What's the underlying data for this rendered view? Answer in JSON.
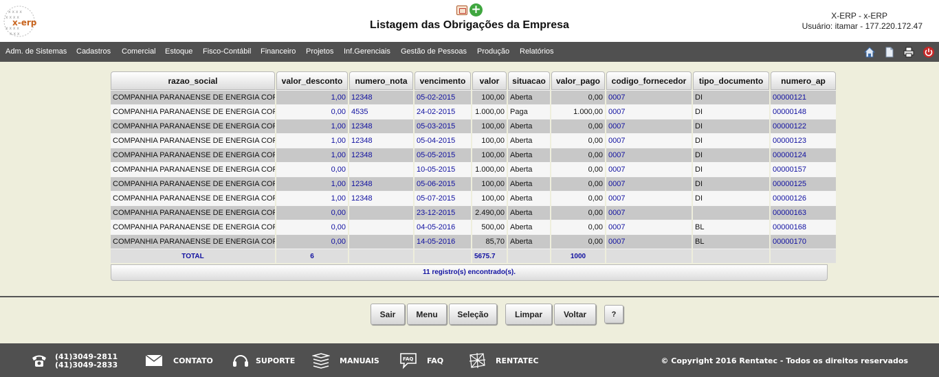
{
  "header": {
    "logo_text": "x-erp",
    "title": "Listagem das Obrigações da Empresa",
    "system_name": "X-ERP - x-ERP",
    "user_info": "Usuário: itamar - 177.220.172.47"
  },
  "menu": {
    "items": [
      "Adm. de Sistemas",
      "Cadastros",
      "Comercial",
      "Estoque",
      "Fisco-Contábil",
      "Financeiro",
      "Projetos",
      "Inf.Gerenciais",
      "Gestão de Pessoas",
      "Produção",
      "Relatórios"
    ]
  },
  "table": {
    "columns": [
      "razao_social",
      "valor_desconto",
      "numero_nota",
      "vencimento",
      "valor",
      "situacao",
      "valor_pago",
      "codigo_fornecedor",
      "tipo_documento",
      "numero_ap"
    ],
    "rows": [
      [
        "COMPANHIA PARANAENSE DE ENERGIA COPEL",
        "1,00",
        "12348",
        "05-02-2015",
        "100,00",
        "Aberta",
        "0,00",
        "0007",
        "DI",
        "00000121"
      ],
      [
        "COMPANHIA PARANAENSE DE ENERGIA COPEL",
        "0,00",
        "4535",
        "24-02-2015",
        "1.000,00",
        "Paga",
        "1.000,00",
        "0007",
        "DI",
        "00000148"
      ],
      [
        "COMPANHIA PARANAENSE DE ENERGIA COPEL",
        "1,00",
        "12348",
        "05-03-2015",
        "100,00",
        "Aberta",
        "0,00",
        "0007",
        "DI",
        "00000122"
      ],
      [
        "COMPANHIA PARANAENSE DE ENERGIA COPEL",
        "1,00",
        "12348",
        "05-04-2015",
        "100,00",
        "Aberta",
        "0,00",
        "0007",
        "DI",
        "00000123"
      ],
      [
        "COMPANHIA PARANAENSE DE ENERGIA COPEL",
        "1,00",
        "12348",
        "05-05-2015",
        "100,00",
        "Aberta",
        "0,00",
        "0007",
        "DI",
        "00000124"
      ],
      [
        "COMPANHIA PARANAENSE DE ENERGIA COPEL",
        "0,00",
        "",
        "10-05-2015",
        "1.000,00",
        "Aberta",
        "0,00",
        "0007",
        "DI",
        "00000157"
      ],
      [
        "COMPANHIA PARANAENSE DE ENERGIA COPEL",
        "1,00",
        "12348",
        "05-06-2015",
        "100,00",
        "Aberta",
        "0,00",
        "0007",
        "DI",
        "00000125"
      ],
      [
        "COMPANHIA PARANAENSE DE ENERGIA COPEL",
        "1,00",
        "12348",
        "05-07-2015",
        "100,00",
        "Aberta",
        "0,00",
        "0007",
        "DI",
        "00000126"
      ],
      [
        "COMPANHIA PARANAENSE DE ENERGIA COPEL",
        "0,00",
        "",
        "23-12-2015",
        "2.490,00",
        "Aberta",
        "0,00",
        "0007",
        "",
        "00000163"
      ],
      [
        "COMPANHIA PARANAENSE DE ENERGIA COPEL",
        "0,00",
        "",
        "04-05-2016",
        "500,00",
        "Aberta",
        "0,00",
        "0007",
        "BL",
        "00000168"
      ],
      [
        "COMPANHIA PARANAENSE DE ENERGIA COPEL",
        "0,00",
        "",
        "14-05-2016",
        "85,70",
        "Aberta",
        "0,00",
        "0007",
        "BL",
        "00000170"
      ]
    ],
    "total": {
      "label": "TOTAL",
      "valor_desconto": "6",
      "valor": "5675.7",
      "valor_pago": "1000"
    },
    "footer_text": "11 registro(s) encontrado(s)."
  },
  "buttons": {
    "sair": "Sair",
    "menu": "Menu",
    "selecao": "Seleção",
    "limpar": "Limpar",
    "voltar": "Voltar",
    "help": "?"
  },
  "footer": {
    "phone1": "(41)3049-2811",
    "phone2": "(41)3049-2833",
    "contato": "CONTATO",
    "suporte": "SUPORTE",
    "manuais": "MANUAIS",
    "faq": "FAQ",
    "rentatec": "RENTATEC",
    "copyright": "© Copyright 2016 Rentatec - Todos os direitos reservados"
  },
  "colors": {
    "menubar": "#505050",
    "page_bg": "#eeeedc",
    "link": "#1010a0"
  }
}
